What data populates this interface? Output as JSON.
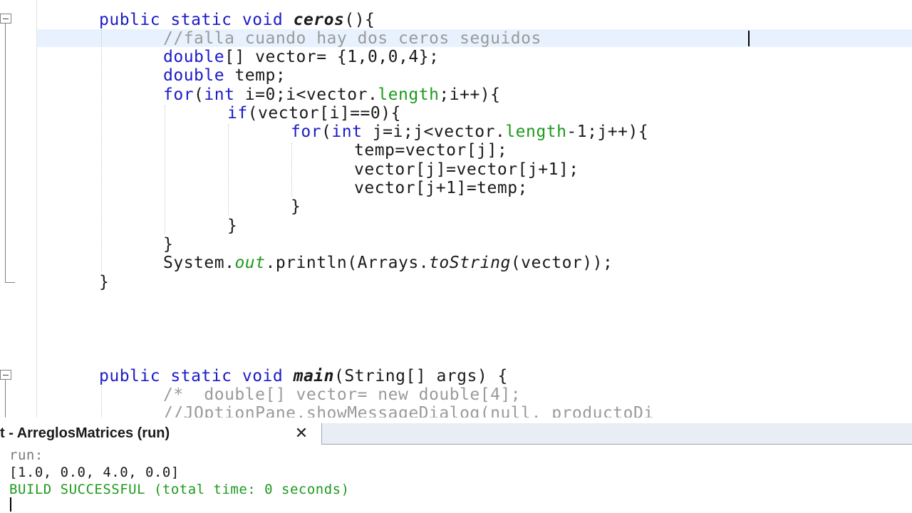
{
  "editor": {
    "lines": [
      [
        {
          "t": "public static void ",
          "c": "kw"
        },
        {
          "t": "ceros",
          "c": "bi"
        },
        {
          "t": "(){",
          "c": ""
        }
      ],
      [
        {
          "t": "//falla cuando hay dos ceros seguidos",
          "c": "cm"
        }
      ],
      [
        {
          "t": "double",
          "c": "kw"
        },
        {
          "t": "[] vector= {1,0,0,4};",
          "c": ""
        }
      ],
      [
        {
          "t": "double",
          "c": "kw"
        },
        {
          "t": " temp;",
          "c": ""
        }
      ],
      [
        {
          "t": "for",
          "c": "kw"
        },
        {
          "t": "(",
          "c": ""
        },
        {
          "t": "int",
          "c": "kw"
        },
        {
          "t": " i=0;i<vector.",
          "c": ""
        },
        {
          "t": "length",
          "c": "fld"
        },
        {
          "t": ";i++){",
          "c": ""
        }
      ],
      [
        {
          "t": "if",
          "c": "kw"
        },
        {
          "t": "(vector[i]==0){",
          "c": ""
        }
      ],
      [
        {
          "t": "for",
          "c": "kw"
        },
        {
          "t": "(",
          "c": ""
        },
        {
          "t": "int",
          "c": "kw"
        },
        {
          "t": " j=i;j<vector.",
          "c": ""
        },
        {
          "t": "length",
          "c": "fld"
        },
        {
          "t": "-1;j++){",
          "c": ""
        }
      ],
      [
        {
          "t": "temp=vector[j];",
          "c": ""
        }
      ],
      [
        {
          "t": "vector[j]=vector[j+1];",
          "c": ""
        }
      ],
      [
        {
          "t": "vector[j+1]=temp;",
          "c": ""
        }
      ],
      [
        {
          "t": "}",
          "c": ""
        }
      ],
      [
        {
          "t": "}",
          "c": ""
        }
      ],
      [
        {
          "t": "}",
          "c": ""
        }
      ],
      [
        {
          "t": "System.",
          "c": ""
        },
        {
          "t": "out",
          "c": "fld it"
        },
        {
          "t": ".println(Arrays.",
          "c": ""
        },
        {
          "t": "toString",
          "c": "it"
        },
        {
          "t": "(vector));",
          "c": ""
        }
      ],
      [
        {
          "t": "}",
          "c": ""
        }
      ],
      [
        {
          "t": "public static void ",
          "c": "kw"
        },
        {
          "t": "main",
          "c": "bi"
        },
        {
          "t": "(String[] args) {",
          "c": ""
        }
      ],
      [
        {
          "t": "/*  double[] vector= new double[4];",
          "c": "cm"
        }
      ],
      [
        {
          "t": "//JOptionPane.showMessageDialog(null, productoDi",
          "c": "cm"
        }
      ]
    ]
  },
  "output": {
    "tab_label": "t - ArreglosMatrices (run)",
    "close_glyph": "✕",
    "lines": [
      {
        "text": "run:",
        "color": "#7a7a7a"
      },
      {
        "text": "[1.0, 0.0, 4.0, 0.0]",
        "color": "#1a1a1a"
      },
      {
        "text": "BUILD SUCCESSFUL (total time: 0 seconds)",
        "color": "#1d9a1d"
      }
    ]
  }
}
